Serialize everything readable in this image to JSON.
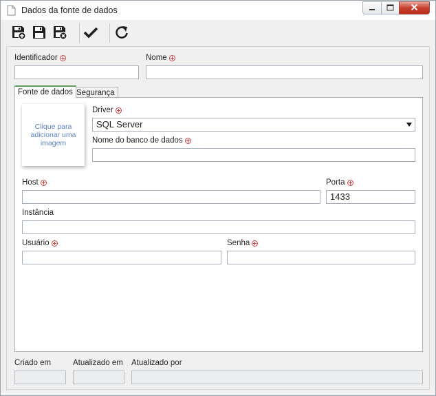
{
  "window": {
    "title": "Dados da fonte de dados",
    "controls": {
      "minimize": "minimize-icon",
      "maximize": "maximize-icon",
      "close": "close-icon"
    }
  },
  "toolbar": {
    "buttons": [
      {
        "name": "save-new",
        "icon": "save-plus-icon"
      },
      {
        "name": "save",
        "icon": "save-icon"
      },
      {
        "name": "save-close",
        "icon": "save-close-icon"
      },
      {
        "name": "confirm",
        "icon": "checkmark-icon"
      },
      {
        "name": "refresh",
        "icon": "refresh-icon"
      }
    ]
  },
  "fields": {
    "identificador": {
      "label": "Identificador",
      "value": "",
      "required": true
    },
    "nome": {
      "label": "Nome",
      "value": "",
      "required": true
    }
  },
  "tabs": [
    {
      "label": "Fonte de dados",
      "active": true
    },
    {
      "label": "Segurança",
      "active": false
    }
  ],
  "fonte": {
    "image_placeholder": "Clique para adicionar uma imagem",
    "driver": {
      "label": "Driver",
      "value": "SQL Server",
      "required": true
    },
    "database": {
      "label": "Nome do banco de dados",
      "value": "",
      "required": true
    },
    "host": {
      "label": "Host",
      "value": "",
      "required": true
    },
    "porta": {
      "label": "Porta",
      "value": "1433",
      "required": true
    },
    "instancia": {
      "label": "Instância",
      "value": ""
    },
    "usuario": {
      "label": "Usuário",
      "value": "",
      "required": true
    },
    "senha": {
      "label": "Senha",
      "value": "",
      "required": true
    }
  },
  "footer": {
    "criado_em": {
      "label": "Criado em",
      "value": ""
    },
    "atualizado_em": {
      "label": "Atualizado em",
      "value": ""
    },
    "atualizado_por": {
      "label": "Atualizado por",
      "value": ""
    }
  },
  "colors": {
    "required": "#d43c3c",
    "tab_accent": "#5ca05c",
    "link": "#5b82c9",
    "close": "#c7402f"
  }
}
